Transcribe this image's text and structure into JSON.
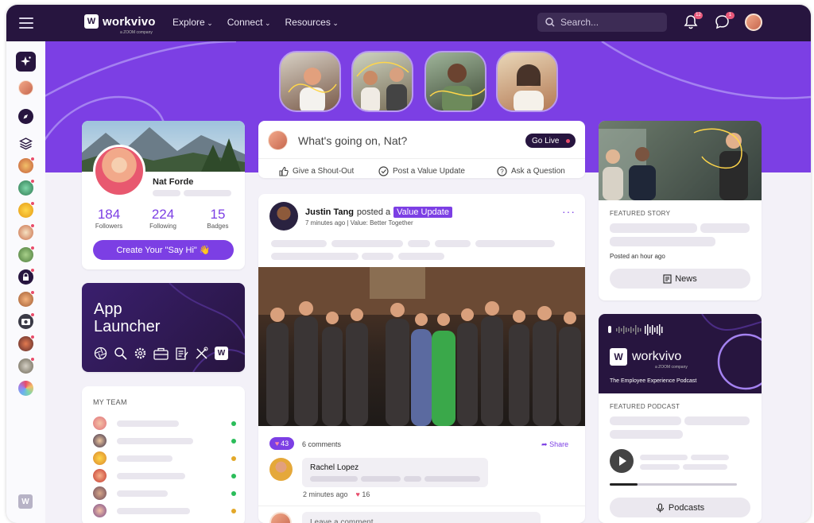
{
  "brand": {
    "name": "workvivo",
    "sub": "a ZOOM company"
  },
  "nav": [
    "Explore",
    "Connect",
    "Resources"
  ],
  "search": {
    "placeholder": "Search..."
  },
  "notifications": {
    "count": "12"
  },
  "messages": {
    "count": "1"
  },
  "profile": {
    "name": "Nat Forde",
    "stats": [
      {
        "value": "184",
        "label": "Followers"
      },
      {
        "value": "224",
        "label": "Following"
      },
      {
        "value": "15",
        "label": "Badges"
      }
    ],
    "cta": "Create Your \"Say Hi\" 👋"
  },
  "app_launcher": {
    "line1": "App",
    "line2": "Launcher"
  },
  "team": {
    "title": "MY TEAM",
    "statuses": [
      "#2bbd5a",
      "#2bbd5a",
      "#e3a829",
      "#2bbd5a",
      "#2bbd5a",
      "#e3a829"
    ]
  },
  "composer": {
    "prompt": "What's going on, Nat?",
    "go_live": "Go Live",
    "actions": [
      "Give a Shout-Out",
      "Post a Value Update",
      "Ask a Question"
    ]
  },
  "post": {
    "author": "Justin Tang",
    "verb": "posted a",
    "tag": "Value Update",
    "meta": "7 minutes ago | Value: Better Together",
    "likes": "43",
    "comments": "6 comments",
    "share": "Share",
    "comment": {
      "author": "Rachel Lopez",
      "time": "2 minutes ago",
      "likes": "16"
    },
    "leave_comment": "Leave a comment"
  },
  "featured_story": {
    "label": "FEATURED STORY",
    "posted": "Posted an hour ago",
    "button": "News"
  },
  "podcast": {
    "brand": "workvivo",
    "sub": "a ZOOM company",
    "tagline": "The Employee Experience Podcast",
    "label": "FEATURED PODCAST",
    "button": "Podcasts",
    "progress": 0.22
  },
  "colors": {
    "primary": "#7c3fe4",
    "dark": "#27153f"
  }
}
